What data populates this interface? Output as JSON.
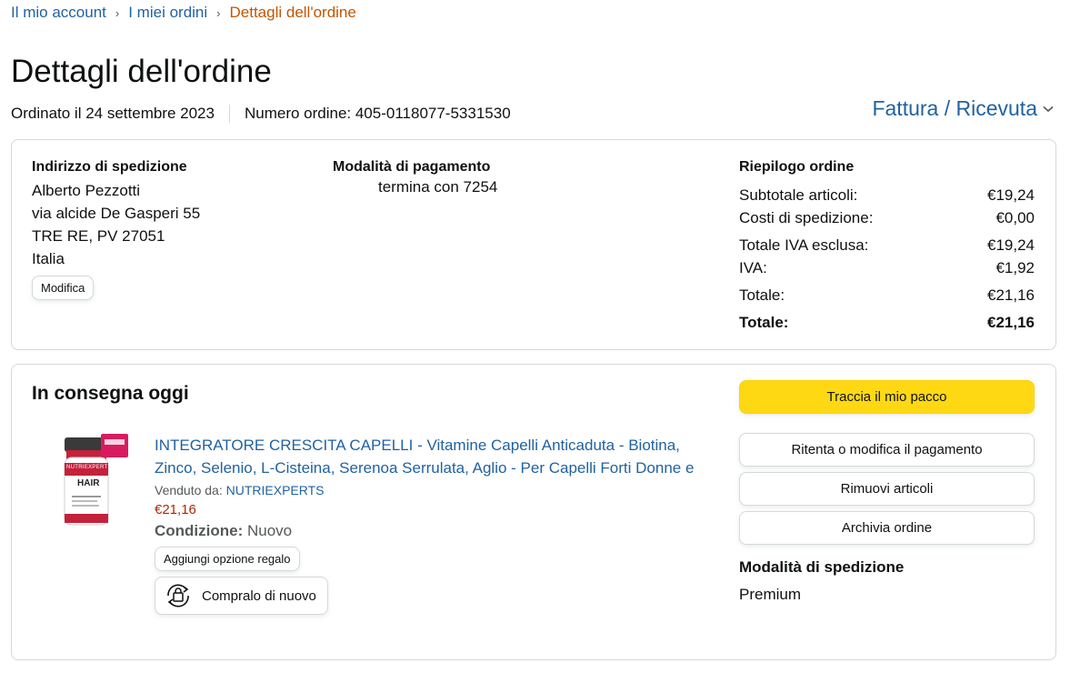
{
  "breadcrumb": {
    "items": [
      "Il mio account",
      "I miei ordini"
    ],
    "separator": "›",
    "current": "Dettagli dell'ordine"
  },
  "page": {
    "title": "Dettagli dell'ordine",
    "ordered_on": "Ordinato il 24 settembre 2023",
    "order_number": "Numero ordine: 405-0118077-5331530",
    "invoice_label": "Fattura / Ricevuta"
  },
  "shipping_address": {
    "heading": "Indirizzo di spedizione",
    "lines": [
      "Alberto Pezzotti",
      "via alcide De Gasperi 55",
      "TRE RE, PV 27051",
      "Italia"
    ],
    "edit_label": "Modifica"
  },
  "payment": {
    "heading": "Modalità di pagamento",
    "card_text": "termina con 7254"
  },
  "summary": {
    "heading": "Riepilogo ordine",
    "rows": [
      {
        "label": "Subtotale articoli:",
        "value": "€19,24"
      },
      {
        "label": "Costi di spedizione:",
        "value": "€0,00"
      },
      {
        "label": "Totale IVA esclusa:",
        "value": "€19,24"
      },
      {
        "label": "IVA:",
        "value": "€1,92"
      },
      {
        "label": "Totale:",
        "value": "€21,16"
      }
    ],
    "grand_total_label": "Totale:",
    "grand_total_value": "€21,16"
  },
  "delivery": {
    "status": "In consegna oggi",
    "product": {
      "title": "INTEGRATORE CRESCITA CAPELLI - Vitamine Capelli Anticaduta - Biotina, Zinco, Selenio, L-Cisteina, Serenoa Serrulata, Aglio - Per Capelli Forti Donne e",
      "sold_by_label": "Venduto da:",
      "seller": "NUTRIEXPERTS",
      "price": "€21,16",
      "condition_label": "Condizione:",
      "condition_value": "Nuovo",
      "gift_option_label": "Aggiungi opzione regalo",
      "buy_again_label": "Compralo di nuovo",
      "image_label_top": "NUTRIEXPERTS",
      "image_label_main": "HAIR"
    },
    "actions": {
      "track": "Traccia il mio pacco",
      "retry_payment": "Ritenta o modifica il pagamento",
      "remove_items": "Rimuovi articoli",
      "archive": "Archivia ordine"
    },
    "shipping_method_heading": "Modalità di spedizione",
    "shipping_method_value": "Premium"
  },
  "colors": {
    "link": "#2162a1",
    "current_crumb": "#c45500",
    "price": "#b12704",
    "track_button": "#ffd814"
  }
}
